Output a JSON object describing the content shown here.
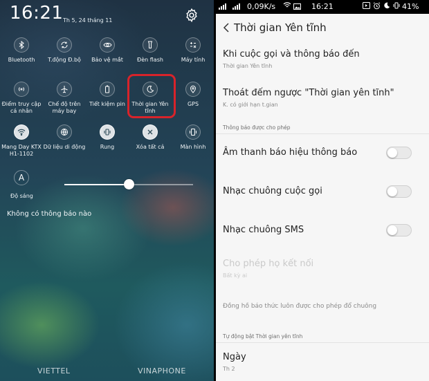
{
  "shade": {
    "time": "16:21",
    "date": "Th 5, 24 tháng 11",
    "tiles": [
      {
        "label": "Bluetooth",
        "icon": "bluetooth-icon",
        "on": false
      },
      {
        "label": "T.động Đ.bộ",
        "icon": "sync-icon",
        "on": false
      },
      {
        "label": "Bảo vệ mắt",
        "icon": "eye-icon",
        "on": false
      },
      {
        "label": "Đèn flash",
        "icon": "flashlight-icon",
        "on": false
      },
      {
        "label": "Máy tính",
        "icon": "calculator-icon",
        "on": false
      },
      {
        "label": "Điểm truy cập cá nhân",
        "icon": "hotspot-icon",
        "on": false
      },
      {
        "label": "Chế độ trên máy bay",
        "icon": "airplane-icon",
        "on": false
      },
      {
        "label": "Tiết kiệm pin",
        "icon": "battery-saver-icon",
        "on": false
      },
      {
        "label": "Thời gian Yên tĩnh",
        "icon": "moon-icon",
        "on": false
      },
      {
        "label": "GPS",
        "icon": "location-icon",
        "on": false
      },
      {
        "label": "Mang Day KTX H1-1102",
        "icon": "wifi-icon",
        "on": true
      },
      {
        "label": "Dữ liệu di động",
        "icon": "globe-icon",
        "on": false
      },
      {
        "label": "Rung",
        "icon": "vibrate-icon",
        "on": false
      },
      {
        "label": "Xóa tất cả",
        "icon": "clear-all-icon",
        "on": false
      },
      {
        "label": "Màn hình",
        "icon": "screen-icon",
        "on": false
      }
    ],
    "brightness_icon_text": "A",
    "brightness_label": "Độ sáng",
    "brightness_level": 0.5,
    "no_notifications": "Không có thông báo nào",
    "carrier_1": "VIETTEL",
    "carrier_2": "VINAPHONE"
  },
  "status": {
    "speed": "0,09K/s",
    "time": "16:21",
    "battery": "41%"
  },
  "settings": {
    "title": "Thời gian Yên tĩnh",
    "calls_title": "Khi cuộc gọi và thông báo đến",
    "calls_sub": "Thời gian Yên tĩnh",
    "countdown_title": "Thoát đếm ngược \"Thời gian yên tĩnh\"",
    "countdown_sub": "K. có giới hạn t.gian",
    "allowed_section": "Thông báo được cho phép",
    "notif_sound": "Âm thanh báo hiệu thông báo",
    "call_ringtone": "Nhạc chuông cuộc gọi",
    "sms_ringtone": "Nhạc chuông SMS",
    "allow_contacts_title": "Cho phép họ kết nối",
    "allow_contacts_sub": "Bất kỳ ai",
    "alarm_note": "Đồng hồ báo thức luôn được cho phép đổ chuông",
    "auto_section": "Tự động bật Thời gian yên tĩnh",
    "day_title": "Ngày",
    "day_sub": "Th 2",
    "toggles": {
      "notif_sound": false,
      "call_ringtone": false,
      "sms_ringtone": false
    }
  }
}
